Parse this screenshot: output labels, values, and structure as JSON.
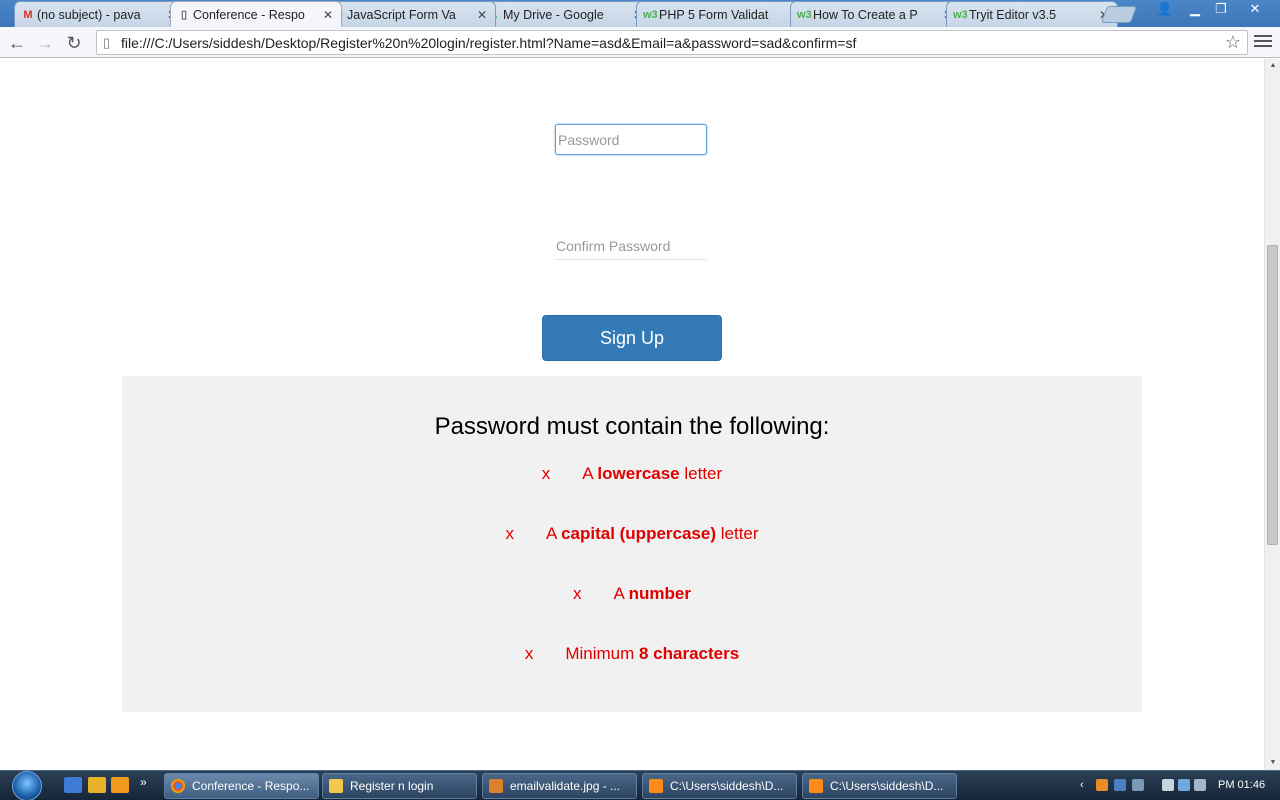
{
  "browser": {
    "tabs": [
      {
        "title": "(no subject) - pava",
        "icon": "gmail-icon",
        "active": false
      },
      {
        "title": "Conference - Respo",
        "icon": "page-icon",
        "active": true
      },
      {
        "title": "JavaScript Form Va",
        "icon": "web-icon",
        "active": false
      },
      {
        "title": "My Drive - Google",
        "icon": "drive-icon",
        "active": false
      },
      {
        "title": "PHP 5 Form Validat",
        "icon": "w3-icon",
        "active": false
      },
      {
        "title": "How To Create a P",
        "icon": "w3-icon",
        "active": false
      },
      {
        "title": "Tryit Editor v3.5",
        "icon": "w3-icon",
        "active": false
      }
    ],
    "url": "file:///C:/Users/siddesh/Desktop/Register%20n%20login/register.html?Name=asd&Email=a&password=sad&confirm=sf"
  },
  "form": {
    "password_placeholder": "Password",
    "confirm_placeholder": "Confirm Password",
    "signup_label": "Sign Up"
  },
  "message": {
    "title": "Password must contain the following:",
    "invalid_mark": "x",
    "rules": [
      {
        "prefix": "A ",
        "bold": "lowercase",
        "suffix": " letter"
      },
      {
        "prefix": "A ",
        "bold": "capital (uppercase)",
        "suffix": " letter"
      },
      {
        "prefix": "A ",
        "bold": "number",
        "suffix": ""
      },
      {
        "prefix": "Minimum ",
        "bold": "8 characters",
        "suffix": ""
      }
    ],
    "color": "#e00000"
  },
  "taskbar": {
    "items": [
      {
        "label": "Conference - Respo...",
        "icon": "chrome-icon",
        "active": true
      },
      {
        "label": "Register n login",
        "icon": "folder-icon",
        "active": false
      },
      {
        "label": "emailvalidate.jpg - ...",
        "icon": "paint-icon",
        "active": false
      },
      {
        "label": "C:\\Users\\siddesh\\D...",
        "icon": "sublime-icon",
        "active": false
      },
      {
        "label": "C:\\Users\\siddesh\\D...",
        "icon": "sublime-icon",
        "active": false
      }
    ],
    "clock": "PM 01:46"
  }
}
